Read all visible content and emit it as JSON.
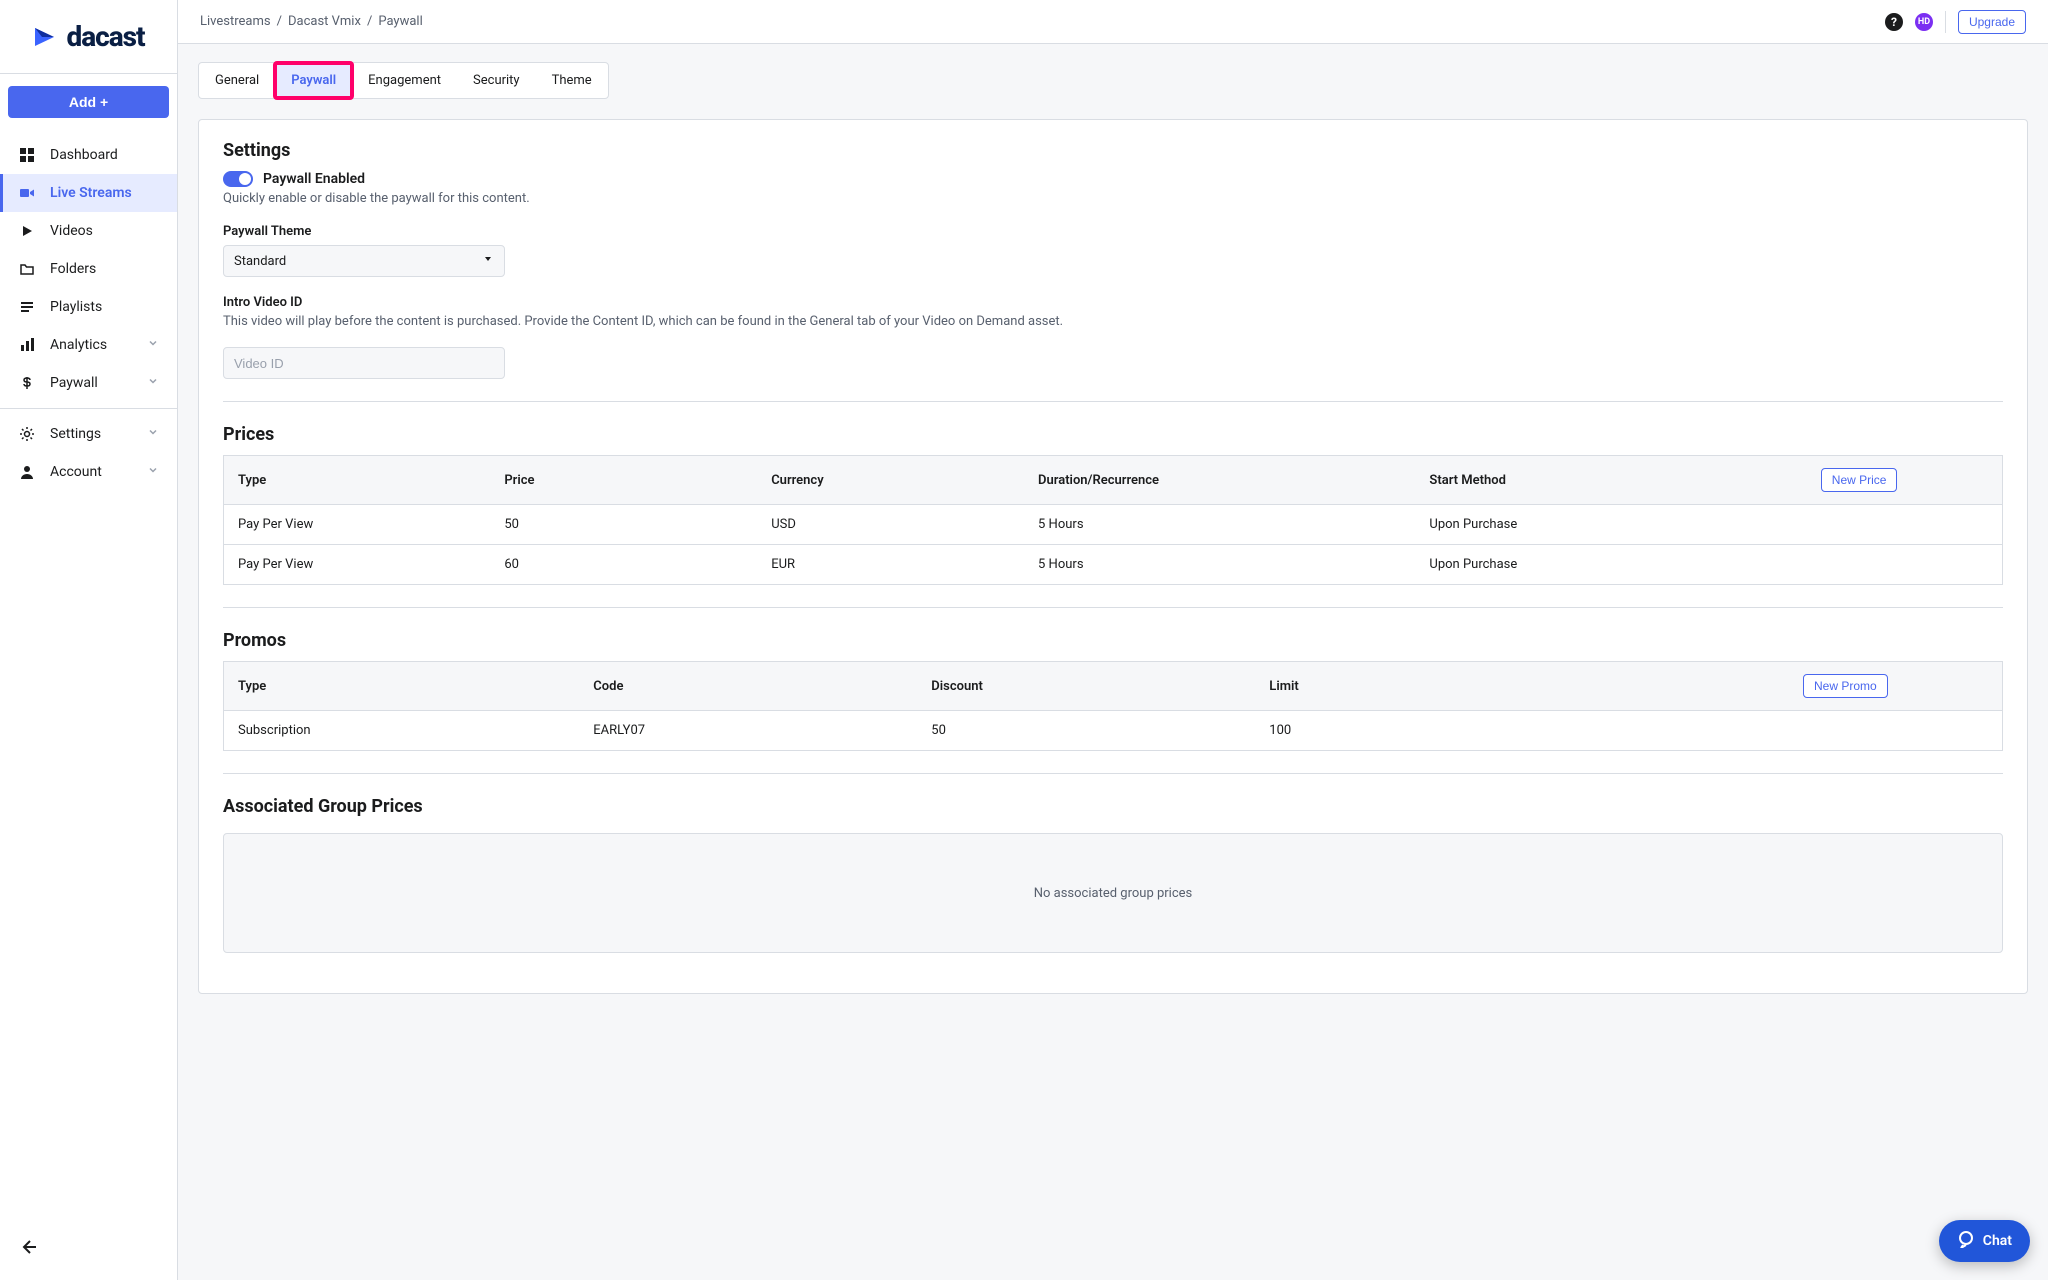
{
  "brand": {
    "name": "dacast"
  },
  "sidebar": {
    "add_label": "Add +",
    "items": [
      {
        "label": "Dashboard"
      },
      {
        "label": "Live Streams"
      },
      {
        "label": "Videos"
      },
      {
        "label": "Folders"
      },
      {
        "label": "Playlists"
      },
      {
        "label": "Analytics"
      },
      {
        "label": "Paywall"
      },
      {
        "label": "Settings"
      },
      {
        "label": "Account"
      }
    ]
  },
  "breadcrumbs": [
    "Livestreams",
    "Dacast Vmix",
    "Paywall"
  ],
  "topbar": {
    "avatar_initials": "HD",
    "upgrade_label": "Upgrade"
  },
  "tabs": [
    "General",
    "Paywall",
    "Engagement",
    "Security",
    "Theme"
  ],
  "settings": {
    "heading": "Settings",
    "toggle_label": "Paywall Enabled",
    "toggle_help": "Quickly enable or disable the paywall for this content.",
    "theme_label": "Paywall Theme",
    "theme_value": "Standard",
    "intro_label": "Intro Video ID",
    "intro_help": "This video will play before the content is purchased. Provide the Content ID, which can be found in the General tab of your Video on Demand asset.",
    "intro_placeholder": "Video ID"
  },
  "prices": {
    "heading": "Prices",
    "new_label": "New Price",
    "columns": [
      "Type",
      "Price",
      "Currency",
      "Duration/Recurrence",
      "Start Method"
    ],
    "rows": [
      {
        "type": "Pay Per View",
        "price": "50",
        "currency": "USD",
        "duration": "5 Hours",
        "start": "Upon Purchase"
      },
      {
        "type": "Pay Per View",
        "price": "60",
        "currency": "EUR",
        "duration": "5 Hours",
        "start": "Upon Purchase"
      }
    ]
  },
  "promos": {
    "heading": "Promos",
    "new_label": "New Promo",
    "columns": [
      "Type",
      "Code",
      "Discount",
      "Limit"
    ],
    "rows": [
      {
        "type": "Subscription",
        "code": "EARLY07",
        "discount": "50",
        "limit": "100"
      }
    ]
  },
  "assoc": {
    "heading": "Associated Group Prices",
    "empty": "No associated group prices"
  },
  "chat": {
    "label": "Chat"
  }
}
